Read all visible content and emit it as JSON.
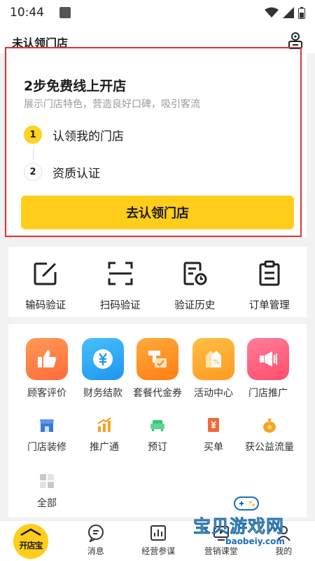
{
  "status_bar": {
    "time": "10:44"
  },
  "header": {
    "title": "未认领门店",
    "icon": "store-profile-icon"
  },
  "promo": {
    "title": "2步免费线上开店",
    "subtitle": "展示门店特色，营造良好口碑，吸引客流",
    "steps": [
      {
        "num": "1",
        "label": "认领我的门店",
        "active": true
      },
      {
        "num": "2",
        "label": "资质认证",
        "active": false
      }
    ],
    "button_label": "去认领门店",
    "accent_color": "#ffcd1a",
    "highlight_color": "#e03232"
  },
  "quick_actions": [
    {
      "label": "输码验证",
      "icon": "edit-square-icon"
    },
    {
      "label": "扫码验证",
      "icon": "scan-icon"
    },
    {
      "label": "验证历史",
      "icon": "history-doc-icon"
    },
    {
      "label": "订单管理",
      "icon": "clipboard-icon"
    }
  ],
  "features_big": [
    {
      "label": "顾客评价",
      "icon": "thumbs-up-icon",
      "color": "#ff7a45"
    },
    {
      "label": "财务结款",
      "icon": "yuan-coin-icon",
      "color": "#2aa8f5"
    },
    {
      "label": "套餐代金券",
      "icon": "coupon-icon",
      "color": "#ff8c1a"
    },
    {
      "label": "活动中心",
      "icon": "percent-tag-icon",
      "color": "#ffab2e"
    },
    {
      "label": "门店推广",
      "icon": "megaphone-icon",
      "color": "#ff5577"
    }
  ],
  "features_small": [
    {
      "label": "门店装修",
      "icon": "storefront-icon",
      "color": "#3a7bd5"
    },
    {
      "label": "推广通",
      "icon": "bar-growth-icon",
      "color": "#f7a325"
    },
    {
      "label": "预订",
      "icon": "sofa-icon",
      "color": "#3fc27a"
    },
    {
      "label": "买单",
      "icon": "yuan-receipt-icon",
      "color": "#f06a3a"
    },
    {
      "label": "获公益流量",
      "icon": "money-bag-icon",
      "color": "#f7a325"
    },
    {
      "label": "全部",
      "icon": "grid-all-icon",
      "color": "#c5c9d0"
    }
  ],
  "tabbar": {
    "logo_text": "开店宝",
    "items": [
      {
        "label": "消息",
        "icon": "message-icon"
      },
      {
        "label": "经营参谋",
        "icon": "analytics-icon"
      },
      {
        "label": "营销课堂",
        "icon": "classroom-icon"
      },
      {
        "label": "我的",
        "icon": "profile-icon"
      }
    ]
  },
  "watermark": {
    "text": "宝贝游戏网",
    "url": "baobeiy.com"
  }
}
